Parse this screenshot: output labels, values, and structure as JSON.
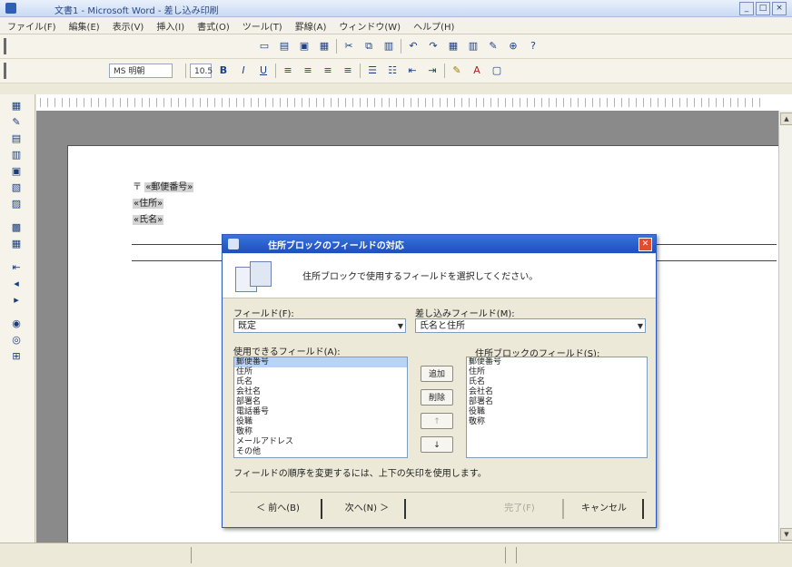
{
  "window": {
    "title": "文書1 - Microsoft Word - 差し込み印刷",
    "buttons": [
      "_",
      "□",
      "×"
    ]
  },
  "menubar": {
    "items": [
      "ファイル(F)",
      "編集(E)",
      "表示(V)",
      "挿入(I)",
      "書式(O)",
      "ツール(T)",
      "罫線(A)",
      "ウィンドウ(W)",
      "ヘルプ(H)"
    ]
  },
  "toolbar2": {
    "font": "MS 明朝",
    "size": "10.5"
  },
  "document": {
    "line1_prefix": "〒",
    "line1_field": "«郵便番号»",
    "line2_field": "«住所»",
    "line3_field": "«氏名»"
  },
  "dialog": {
    "title": "住所ブロックのフィールドの対応",
    "header_text": "住所ブロックで使用するフィールドを選択してください。",
    "left_label": "フィールド(F):",
    "left_select": "既定",
    "right_label": "差し込みフィールド(M):",
    "right_select": "氏名と住所",
    "available_label": "使用できるフィールド(A):",
    "available_fields": [
      "郵便番号",
      "住所",
      "氏名",
      "会社名",
      "部署名",
      "電話番号",
      "役職",
      "敬称",
      "メールアドレス",
      "その他"
    ],
    "selected_label": "住所ブロックのフィールド(S):",
    "selected_fields": [
      "郵便番号",
      "住所",
      "氏名",
      "会社名",
      "部署名",
      "役職",
      "敬称"
    ],
    "btn_add": "追加",
    "btn_remove": "削除",
    "btn_up": "↑",
    "btn_down": "↓",
    "note": "フィールドの順序を変更するには、上下の矢印を使用します。",
    "btn_back": "＜ 前へ(B)",
    "btn_next": "次へ(N) ＞",
    "btn_finish": "完了(F)",
    "btn_cancel": "キャンセル"
  }
}
